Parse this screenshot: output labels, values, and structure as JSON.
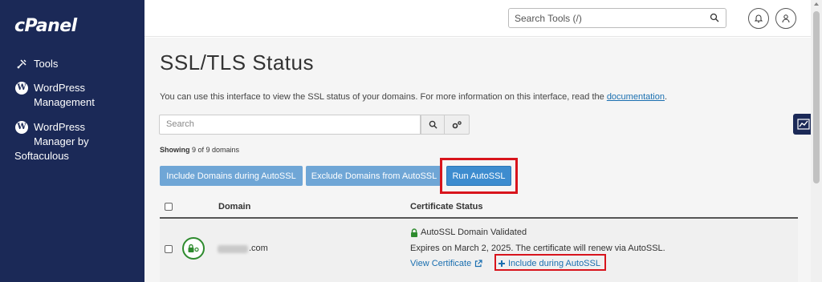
{
  "sidebar": {
    "logo": "cPanel",
    "items": [
      {
        "icon": "tools-icon",
        "label": "Tools"
      },
      {
        "icon": "wordpress-icon",
        "line1": "WordPress",
        "line2": "Management"
      },
      {
        "icon": "wordpress-icon",
        "line1": "WordPress",
        "line2": "Manager by",
        "line3": "Softaculous"
      }
    ]
  },
  "header": {
    "search_placeholder": "Search Tools (/)"
  },
  "main": {
    "title": "SSL/TLS Status",
    "intro_text": "You can use this interface to view the SSL status of your domains. For more information on this interface, read the ",
    "intro_link": "documentation",
    "intro_end": ".",
    "search_placeholder": "Search",
    "showing_label": "Showing",
    "showing_rest": " 9 of 9 domains",
    "buttons": {
      "include": "Include Domains during AutoSSL",
      "exclude": "Exclude Domains from AutoSSL",
      "run": "Run AutoSSL"
    },
    "table": {
      "headers": {
        "domain": "Domain",
        "status": "Certificate Status"
      },
      "rows": [
        {
          "domain_tld": ".com",
          "status_title": "AutoSSL Domain Validated",
          "status_detail": "Expires on March 2, 2025. The certificate will renew via AutoSSL.",
          "view_certificate": "View Certificate",
          "include_link": "Include during AutoSSL"
        }
      ]
    }
  },
  "colors": {
    "sidebar": "#1b2957",
    "primary_button": "#3d8ccf",
    "highlight": "#d8141c",
    "success": "#2e8b2e"
  }
}
